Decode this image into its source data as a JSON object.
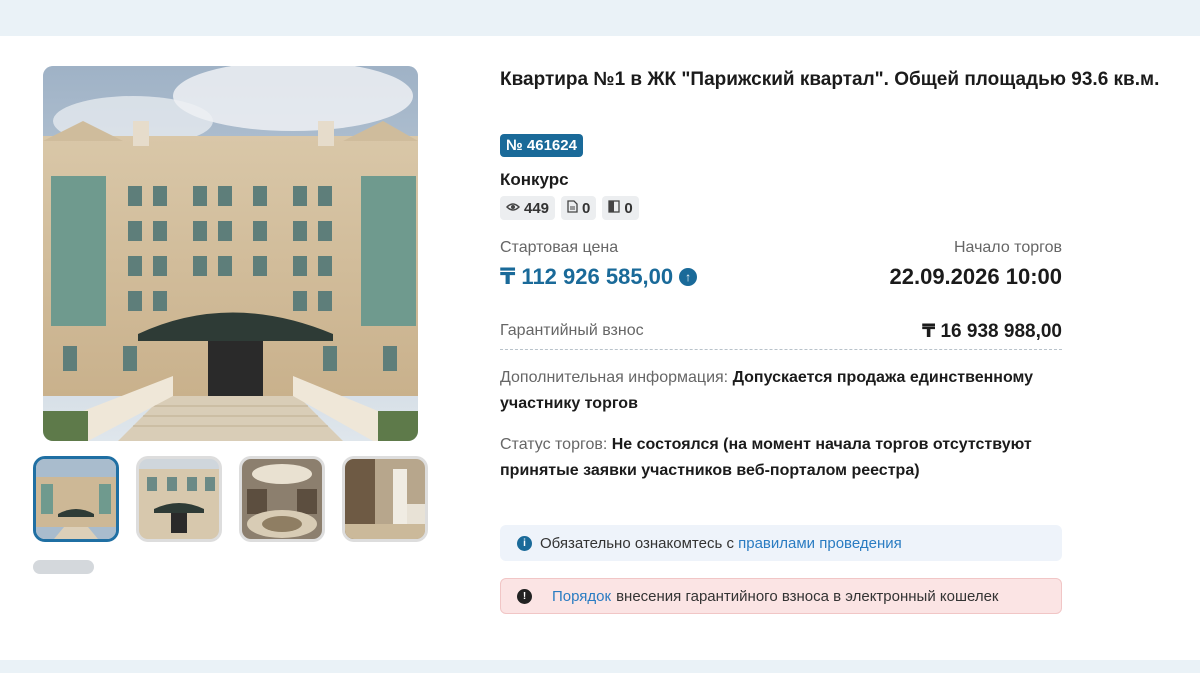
{
  "lot": {
    "title": "Квартира №1 в ЖК \"Парижский квартал\". Общей площадью 93.6 кв.м.",
    "number_badge": "№ 461624",
    "auction_type": "Конкурс",
    "stats": {
      "views": "449",
      "documents": "0",
      "bookmarks": "0"
    }
  },
  "pricing": {
    "start_price_label": "Стартовая цена",
    "start_price": "₸ 112 926 585,00",
    "start_date_label": "Начало торгов",
    "start_date": "22.09.2026 10:00",
    "guarantee_label": "Гарантийный взнос",
    "guarantee_value": "₸ 16 938 988,00"
  },
  "additional": {
    "label": "Дополнительная информация:",
    "value": "Допускается продажа единственному участнику торгов"
  },
  "status": {
    "label": "Статус торгов:",
    "value": "Не состоялся (на момент начала торгов отсутствуют принятые заявки участников веб-порталом реестра)"
  },
  "notices": {
    "rules_prefix": "Обязательно ознакомтесь с",
    "rules_link": "правилами проведения",
    "deposit_link": "Порядок",
    "deposit_text": "внесения гарантийного взноса в электронный кошелек"
  },
  "gallery": {
    "thumbnail_count": 4,
    "active_index": 0
  },
  "icons": {
    "views": "eye-icon",
    "documents": "document-icon",
    "bookmarks": "bookmark-icon",
    "price_trend": "arrow-up-circle-icon",
    "info": "info-icon"
  },
  "colors": {
    "accent": "#1a6a99",
    "link": "#2a7cc2",
    "warning_bg": "#fbe4e4",
    "info_bg": "#eef3fa"
  }
}
